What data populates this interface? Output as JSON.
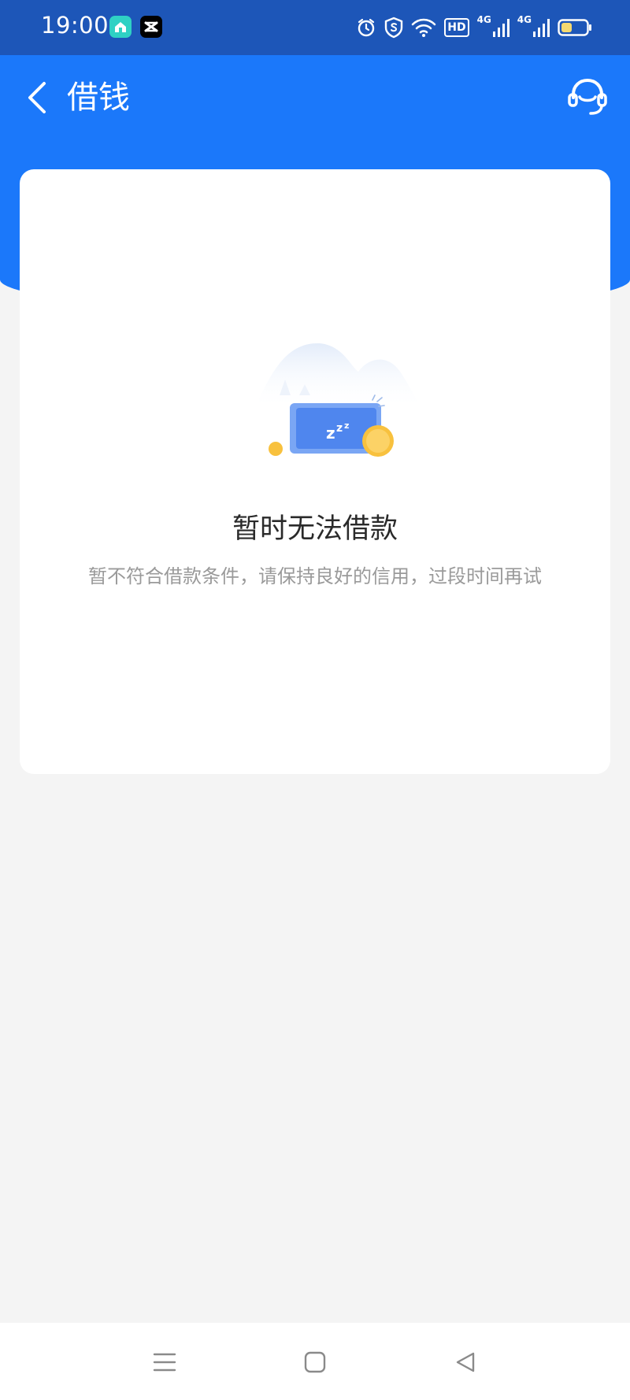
{
  "status_bar": {
    "time": "19:00",
    "hd_label": "HD",
    "network_1": "4G",
    "network_2": "4G",
    "icons": [
      "app-home-icon",
      "capcut-icon",
      "alarm-icon",
      "shield-icon",
      "wifi-icon",
      "hd-icon",
      "signal-4g-icon",
      "signal-4g-icon",
      "battery-icon"
    ]
  },
  "header": {
    "title": "借钱",
    "back_icon": "chevron-left-icon",
    "support_icon": "customer-service-headset-icon"
  },
  "empty_state": {
    "title": "暂时无法借款",
    "subtitle": "暂不符合借款条件，请保持良好的信用，过段时间再试",
    "illustration_text": "zzz"
  },
  "nav_bar": {
    "items": [
      "menu-icon",
      "home-square-icon",
      "back-triangle-icon"
    ]
  },
  "colors": {
    "status_bar_bg": "#1d56b8",
    "header_bg": "#1b78fa",
    "page_bg": "#f4f4f4",
    "card_bg": "#ffffff",
    "title_text": "#2a2a2a",
    "subtitle_text": "#9a9a9a",
    "coin": "#f8c13e"
  }
}
